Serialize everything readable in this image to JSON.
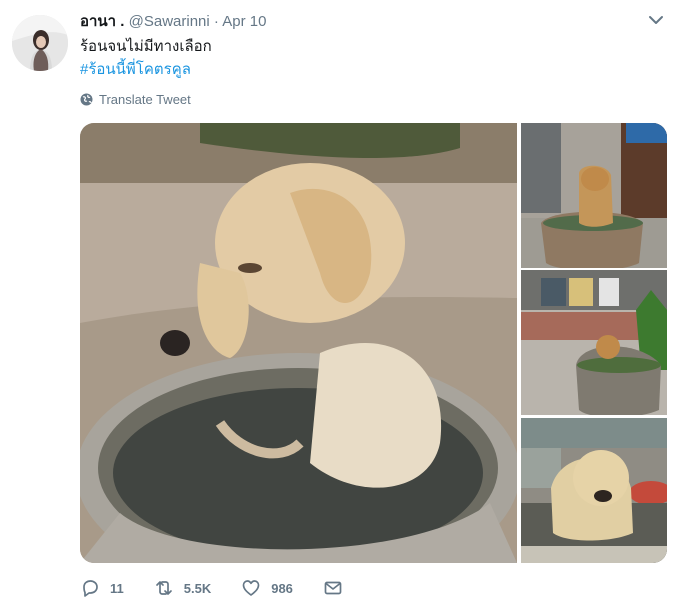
{
  "tweet": {
    "display_name": "อานา .",
    "handle": "@Sawarinni",
    "separator": "·",
    "date": "Apr 10",
    "text": "ร้อนจนไม่มีทางเลือก",
    "hashtag": "#ร้อนนี้พี่โคตรคูล",
    "translate_label": "Translate Tweet"
  },
  "actions": {
    "reply_count": "11",
    "retweet_count": "5.5K",
    "like_count": "986"
  },
  "icons": [
    "avatar",
    "chevron-down-icon",
    "globe-icon",
    "reply-icon",
    "retweet-icon",
    "like-icon",
    "share-icon"
  ],
  "colors": {
    "link": "#1b95e0",
    "muted": "#657786",
    "text": "#14171a"
  }
}
